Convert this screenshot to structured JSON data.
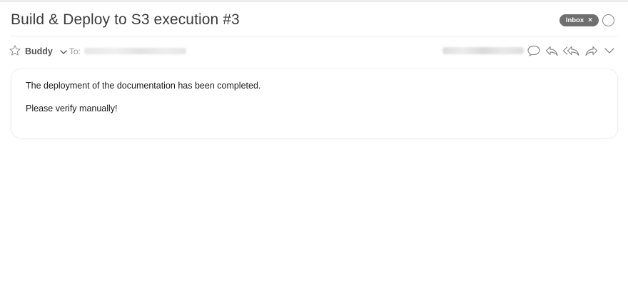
{
  "message": {
    "subject": "Build & Deploy to S3 execution #3",
    "label": {
      "text": "Inbox",
      "remove_glyph": "×"
    },
    "sender": {
      "name": "Buddy"
    },
    "recipients": {
      "to_label": "To:"
    },
    "body": {
      "lines": [
        "The deployment of the documentation has been completed.",
        "Please verify manually!"
      ]
    }
  },
  "icons": {
    "star": "star-icon",
    "sender_menu": "chevron-down-icon",
    "read_status": "circle-icon",
    "actions": [
      "comment-icon",
      "reply-icon",
      "reply-all-icon",
      "forward-icon",
      "chevron-down-icon"
    ]
  },
  "colors": {
    "label_bg": "#6f6f6f",
    "subject_text": "#3b3b3b",
    "icon_stroke": "#8a8a8a"
  }
}
